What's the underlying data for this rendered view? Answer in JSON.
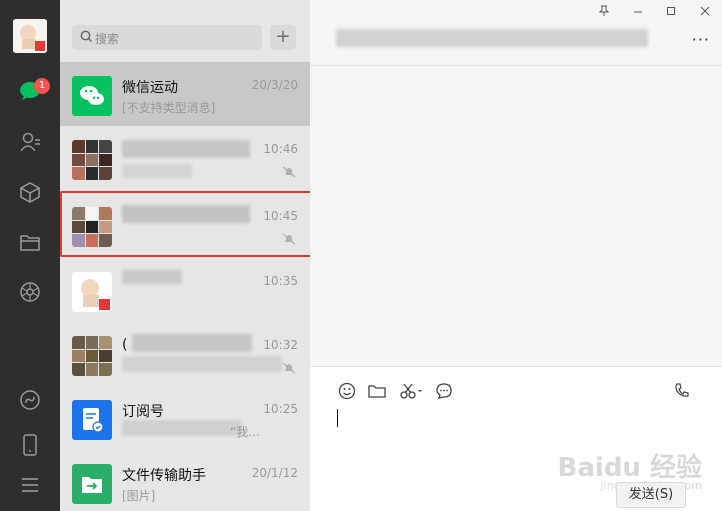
{
  "search": {
    "placeholder": "搜索"
  },
  "nav": {
    "unread_badge": "1"
  },
  "chats": [
    {
      "name": "微信运动",
      "time": "20/3/20",
      "preview": "[不支持类型消息]"
    },
    {
      "name": "",
      "time": "10:46",
      "preview": ""
    },
    {
      "name": "",
      "time": "10:45",
      "preview": ""
    },
    {
      "name": "",
      "time": "10:35",
      "preview": ""
    },
    {
      "name": "(",
      "time": "10:32",
      "preview": ""
    },
    {
      "name": "订阅号",
      "time": "10:25",
      "preview": "“我..."
    },
    {
      "name": "文件传输助手",
      "time": "20/1/12",
      "preview": "[图片]"
    }
  ],
  "composer": {
    "send_label": "发送(S)"
  },
  "watermark": {
    "brand": "Baidu 经验",
    "url": "jingyan.baidu.com"
  },
  "colors": {
    "nav_bg": "#2e2e2e",
    "list_bg": "#e6e6e6",
    "chat_bg": "#f5f5f5",
    "badge": "#fa5151",
    "wechat_green": "#07c160",
    "subscription_blue": "#1a73e8",
    "highlight_red": "#e53935"
  }
}
